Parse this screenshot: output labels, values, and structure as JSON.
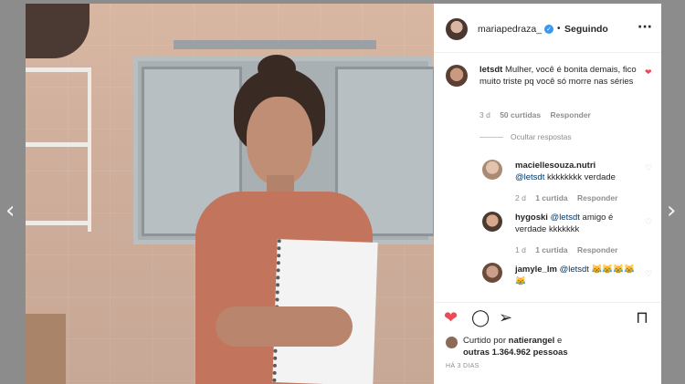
{
  "nav": {
    "prev_icon": "chevron-left-icon",
    "next_icon": "chevron-right-icon",
    "prev_glyph": "‹",
    "next_glyph": "›"
  },
  "post": {
    "author": "mariapedraza_",
    "verified_glyph": "✓",
    "separator": "•",
    "follow_label": "Seguindo",
    "more_glyph": "···"
  },
  "comments": [
    {
      "user": "letsdt",
      "text": "Mulher, você é bonita demais, fico muito triste pq você só morre nas séries",
      "time": "3 d",
      "likes": "50 curtidas",
      "reply": "Responder",
      "liked": true
    }
  ],
  "hide_replies": "Ocultar respostas",
  "replies": [
    {
      "user": "maciellesouza.nutri",
      "mention": "@letsdt",
      "text": " kkkkkkkk verdade",
      "time": "2 d",
      "likes": "1 curtida",
      "reply": "Responder"
    },
    {
      "user": "hygoski",
      "mention": "@letsdt",
      "text": " amigo é verdade kkkkkkk",
      "time": "1 d",
      "likes": "1 curtida",
      "reply": "Responder"
    },
    {
      "user": "jamyle_lm",
      "mention": "@letsdt",
      "text": " 😹😹😹😹😹"
    }
  ],
  "actions": {
    "like_glyph": "❤",
    "comment_glyph": "◯",
    "share_glyph": "➢",
    "save_glyph": "⊓"
  },
  "likes": {
    "prefix": "Curtido por ",
    "user": "natierangel",
    "suffix": " e",
    "others": "outras 1.364.962 pessoas"
  },
  "timestamp": "HÁ 3 DIAS",
  "colors": {
    "like_red": "#ed4956",
    "verified_blue": "#3897f0"
  }
}
